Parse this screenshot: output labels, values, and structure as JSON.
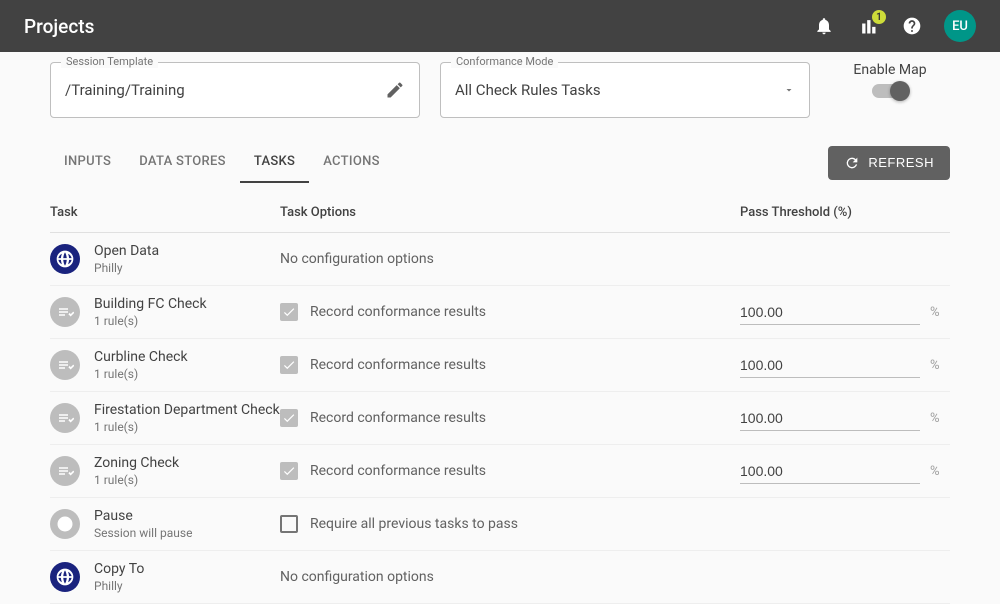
{
  "header": {
    "title": "Projects",
    "chart_badge": "1",
    "avatar_initials": "EU"
  },
  "session_template": {
    "label": "Session Template",
    "value": "/Training/Training"
  },
  "conformance_mode": {
    "label": "Conformance Mode",
    "value": "All Check Rules Tasks"
  },
  "enable_map_label": "Enable Map",
  "tabs": {
    "inputs": "INPUTS",
    "data_stores": "DATA STORES",
    "tasks": "TASKS",
    "actions": "ACTIONS"
  },
  "refresh_label": "REFRESH",
  "columns": {
    "task": "Task",
    "options": "Task Options",
    "threshold": "Pass Threshold (%)"
  },
  "options_text": {
    "no_config": "No configuration options",
    "record_conformance": "Record conformance results",
    "require_previous": "Require all previous tasks to pass"
  },
  "threshold_suffix": "%",
  "tasks_list": [
    {
      "icon": "globe",
      "title": "Open Data",
      "sub": "Philly",
      "option_kind": "none",
      "threshold": ""
    },
    {
      "icon": "check",
      "title": "Building FC Check",
      "sub": "1 rule(s)",
      "option_kind": "checked",
      "threshold": "100.00"
    },
    {
      "icon": "check",
      "title": "Curbline Check",
      "sub": "1 rule(s)",
      "option_kind": "checked",
      "threshold": "100.00"
    },
    {
      "icon": "check",
      "title": "Firestation Department Check",
      "sub": "1 rule(s)",
      "option_kind": "checked",
      "threshold": "100.00"
    },
    {
      "icon": "check",
      "title": "Zoning Check",
      "sub": "1 rule(s)",
      "option_kind": "checked",
      "threshold": "100.00"
    },
    {
      "icon": "clock",
      "title": "Pause",
      "sub": "Session will pause",
      "option_kind": "unchecked",
      "threshold": ""
    },
    {
      "icon": "globe",
      "title": "Copy To",
      "sub": "Philly",
      "option_kind": "none",
      "threshold": ""
    }
  ]
}
